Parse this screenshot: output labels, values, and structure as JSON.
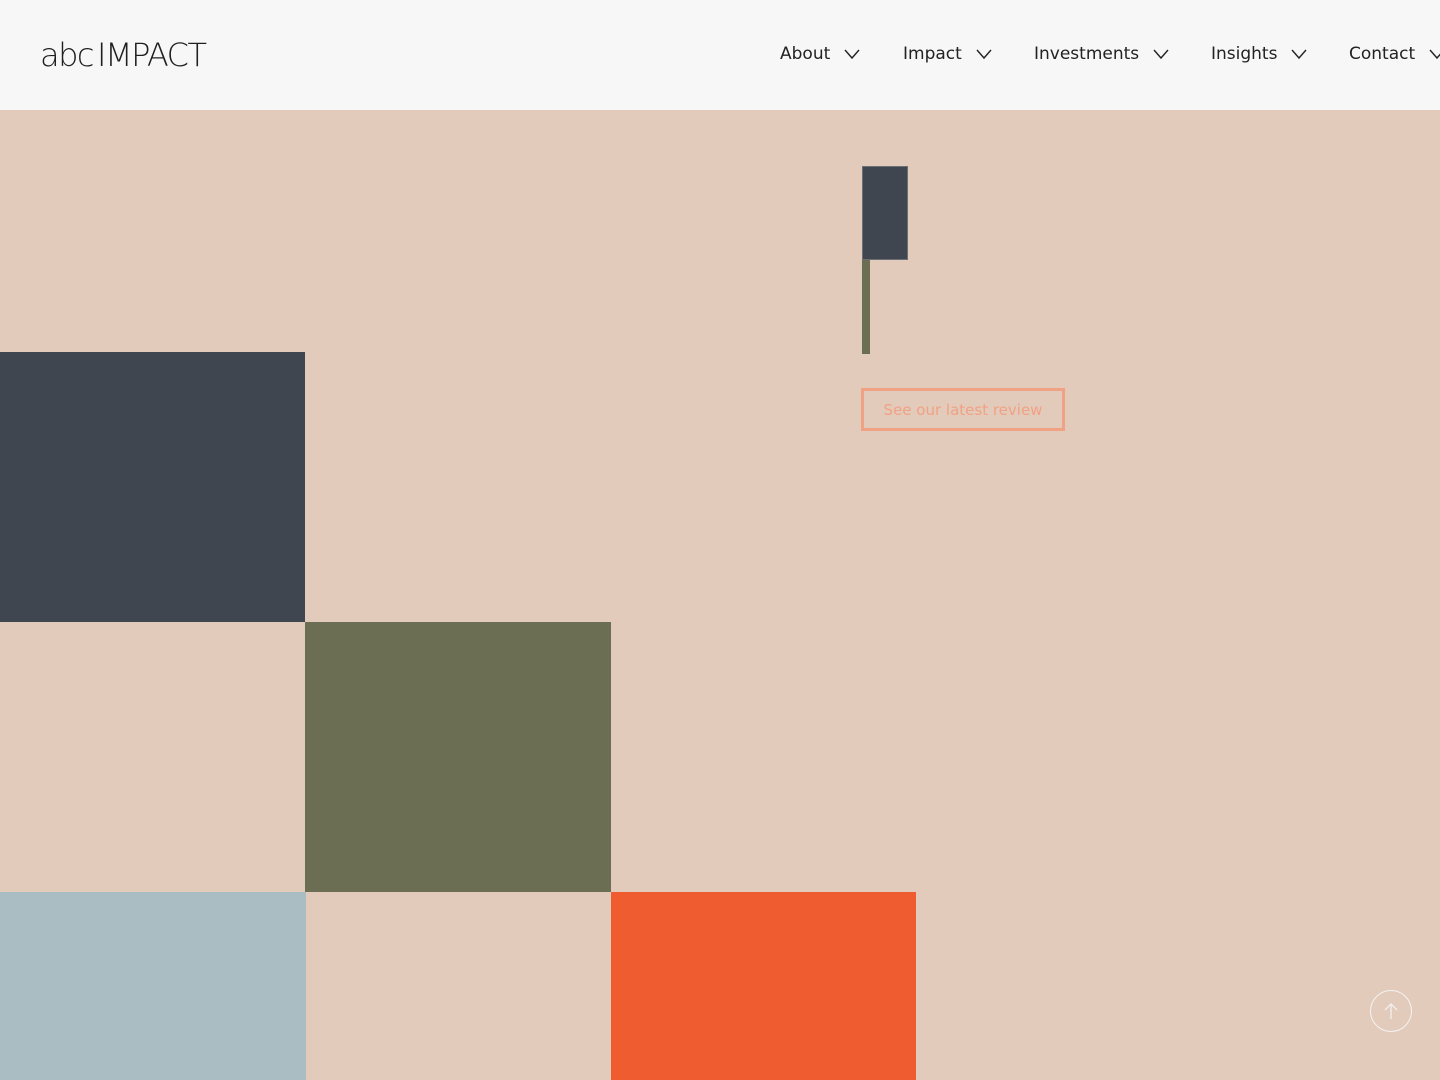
{
  "header": {
    "logo": {
      "prefix": "abc",
      "name": "IMPACT"
    },
    "nav": [
      {
        "label": "About"
      },
      {
        "label": "Impact"
      },
      {
        "label": "Investments"
      },
      {
        "label": "Insights"
      },
      {
        "label": "Contact"
      }
    ]
  },
  "hero": {
    "cta_label": "See our latest review"
  },
  "colors": {
    "background": "#e3cbbc",
    "header": "#f7f7f7",
    "navy": "#3f4650",
    "olive": "#6b6e53",
    "blue_grey": "#aabdc2",
    "orange": "#ee5c30",
    "cta_outline": "#f1a184"
  },
  "icons": {
    "nav_chevron": "chevron-down-icon",
    "scroll_top": "arrow-up-icon"
  }
}
